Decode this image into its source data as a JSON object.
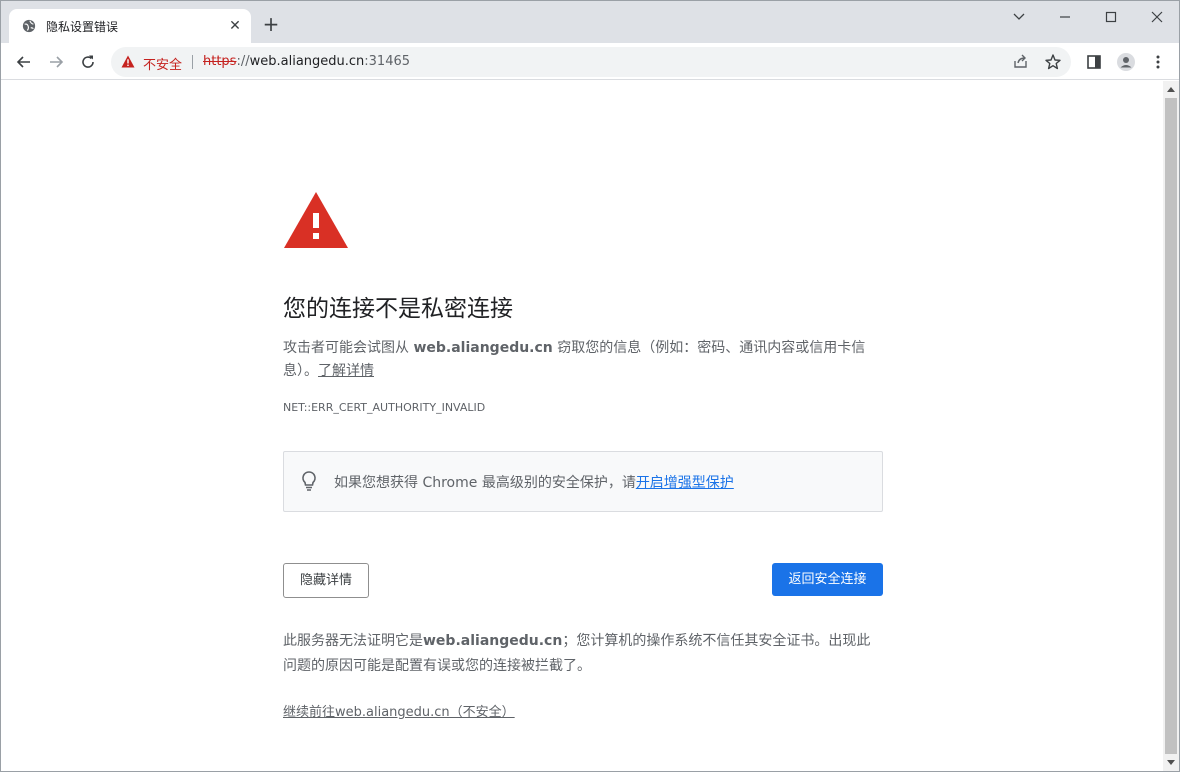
{
  "tab": {
    "title": "隐私设置错误",
    "close": "✕",
    "favicon": "globe-icon"
  },
  "newtab": {
    "label": "+"
  },
  "window_controls": {
    "icons": [
      "chevron-down-icon",
      "minimize-icon",
      "maximize-icon",
      "close-icon"
    ]
  },
  "toolbar": {
    "icons": [
      "back-arrow-icon",
      "forward-arrow-icon",
      "reload-icon",
      "share-icon",
      "star-icon",
      "side-panel-icon",
      "profile-icon",
      "kebab-menu-icon"
    ]
  },
  "omnibox": {
    "security_label": "不安全",
    "scheme": "https",
    "separator": "://",
    "host": "web.aliangedu.cn",
    "port": ":31465"
  },
  "page": {
    "heading": "您的连接不是私密连接",
    "desc_prefix": "攻击者可能会试图从 ",
    "desc_host": "web.aliangedu.cn",
    "desc_suffix": " 窃取您的信息（例如：密码、通讯内容或信用卡信息）。",
    "learn_more": "了解详情",
    "error_code": "NET::ERR_CERT_AUTHORITY_INVALID",
    "tip_text": "如果您想获得 Chrome 最高级别的安全保护，请",
    "tip_link": "开启增强型保护",
    "hide_details_button": "隐藏详情",
    "back_button": "返回安全连接",
    "details_prefix": "此服务器无法证明它是",
    "details_host": "web.aliangedu.cn",
    "details_suffix": "；您计算机的操作系统不信任其安全证书。出现此问题的原因可能是配置有误或您的连接被拦截了。",
    "proceed_link": "继续前往web.aliangedu.cn（不安全）"
  },
  "colors": {
    "danger": "#d93025",
    "link": "#1a73e8",
    "button_primary": "#1a73e8"
  }
}
